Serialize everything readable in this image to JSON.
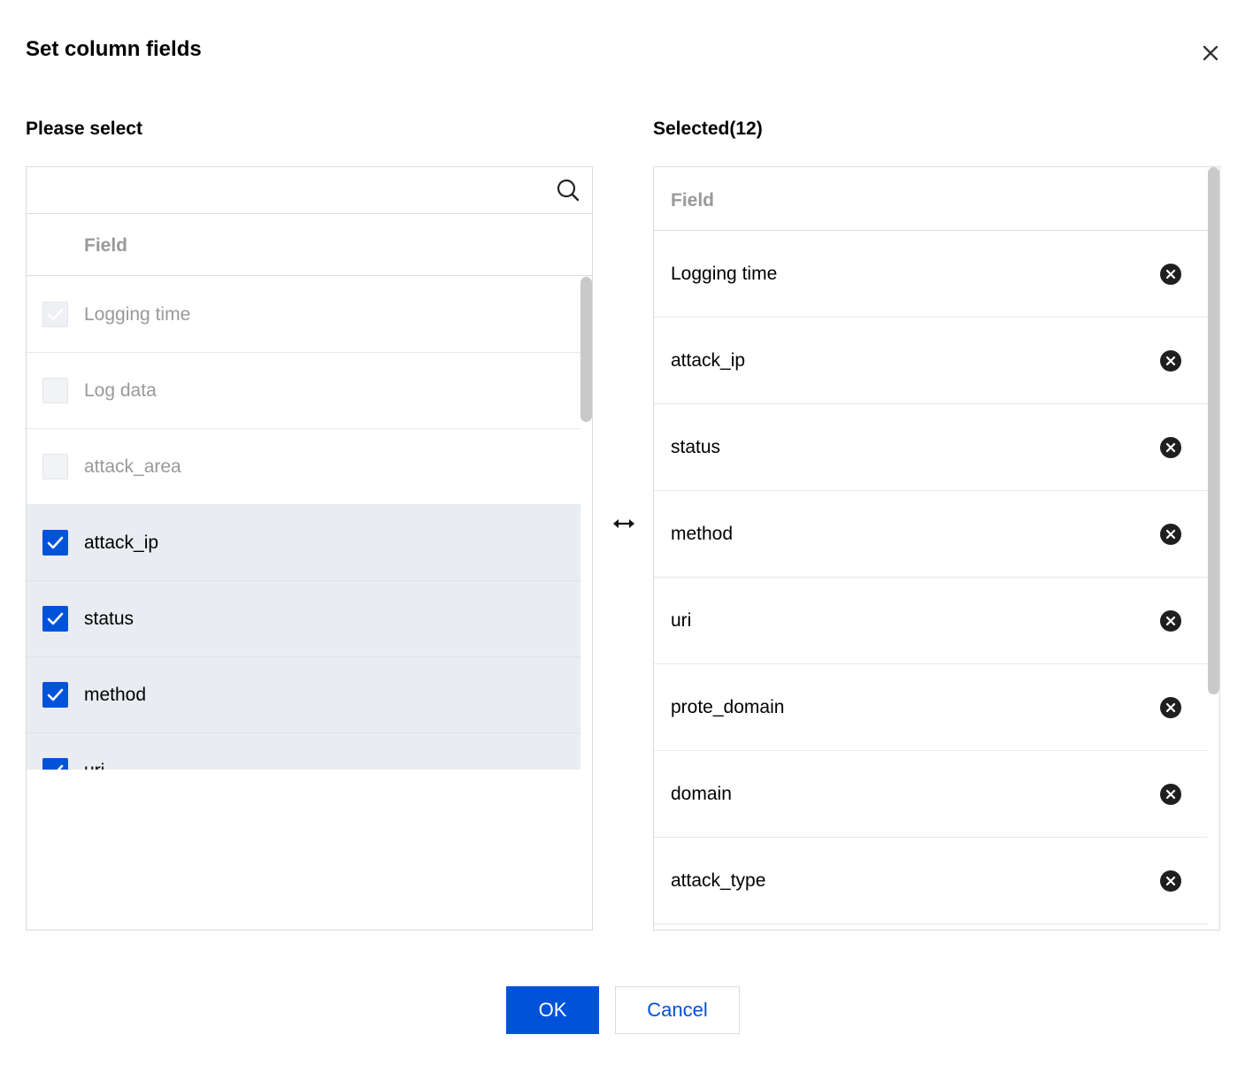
{
  "dialog": {
    "title": "Set column fields",
    "close_icon": "close-icon"
  },
  "source": {
    "label": "Please select",
    "search": {
      "value": "",
      "placeholder": "",
      "icon": "search-icon"
    },
    "column_header": "Field",
    "items": [
      {
        "label": "Logging time",
        "checked": true,
        "disabled": true
      },
      {
        "label": "Log data",
        "checked": false,
        "disabled": true
      },
      {
        "label": "attack_area",
        "checked": false,
        "disabled": true
      },
      {
        "label": "attack_ip",
        "checked": true,
        "disabled": false
      },
      {
        "label": "status",
        "checked": true,
        "disabled": false
      },
      {
        "label": "method",
        "checked": true,
        "disabled": false
      },
      {
        "label": "uri",
        "checked": true,
        "disabled": false
      }
    ]
  },
  "transfer": {
    "icon": "swap-horizontal-icon"
  },
  "target": {
    "label": "Selected(12)",
    "column_header": "Field",
    "items": [
      {
        "label": "Logging time"
      },
      {
        "label": "attack_ip"
      },
      {
        "label": "status"
      },
      {
        "label": "method"
      },
      {
        "label": "uri"
      },
      {
        "label": "prote_domain"
      },
      {
        "label": "domain"
      },
      {
        "label": "attack_type"
      },
      {
        "label": ""
      }
    ],
    "remove_icon": "close-circle-icon"
  },
  "footer": {
    "ok_label": "OK",
    "cancel_label": "Cancel"
  },
  "colors": {
    "primary": "#0052d9",
    "checked_row_bg": "#e9ecf1",
    "muted_text": "#999999",
    "border": "#dcdcdc"
  }
}
